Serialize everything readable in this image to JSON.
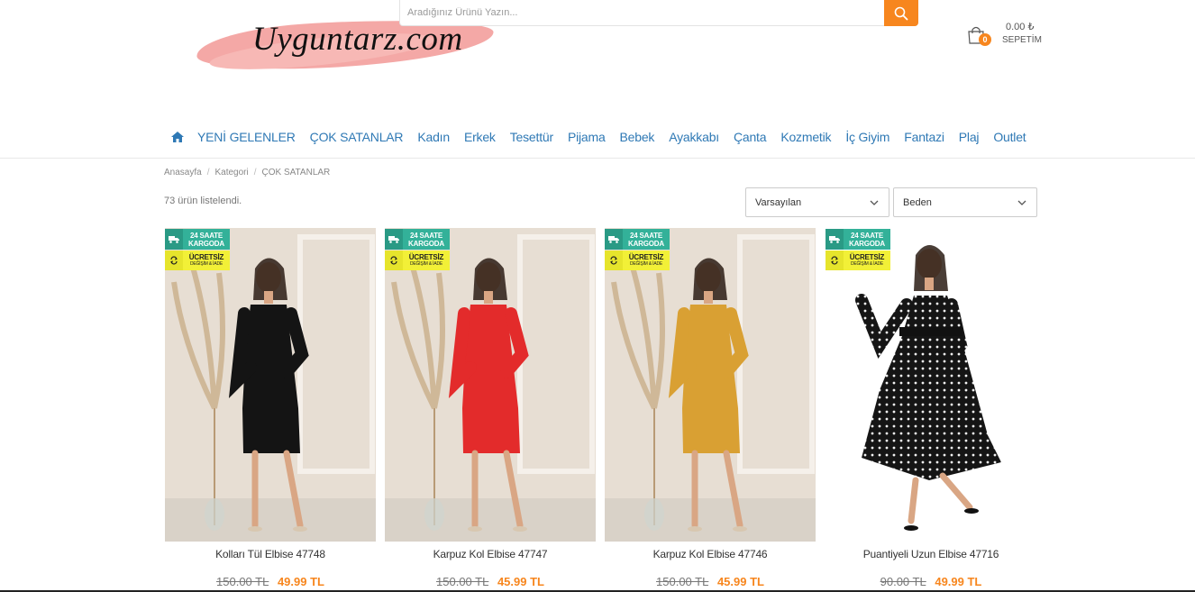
{
  "header": {
    "logo_text": "Uyguntarz.com",
    "search_placeholder": "Aradığınız Ürünü Yazın...",
    "cart": {
      "amount": "0.00 ₺",
      "label": "SEPETİM",
      "count": "0"
    }
  },
  "nav": {
    "items": [
      "YENİ GELENLER",
      "ÇOK SATANLAR",
      "Kadın",
      "Erkek",
      "Tesettür",
      "Pijama",
      "Bebek",
      "Ayakkabı",
      "Çanta",
      "Kozmetik",
      "İç Giyim",
      "Fantazi",
      "Plaj",
      "Outlet"
    ]
  },
  "breadcrumb": [
    "Anasayfa",
    "Kategori",
    "ÇOK SATANLAR"
  ],
  "listing": {
    "count_text": "73 ürün listelendi.",
    "sort_value": "Varsayılan",
    "size_value": "Beden"
  },
  "badges": {
    "shipping_line1": "24 SAATE",
    "shipping_line2": "KARGODA",
    "return_line1": "ÜCRETSİZ",
    "return_line2": "DEĞİŞİM & İADE"
  },
  "products": [
    {
      "title": "Kolları Tül Elbise 47748",
      "old_price": "150.00 TL",
      "new_price": "49.99 TL",
      "dress_color": "#141414"
    },
    {
      "title": "Karpuz Kol Elbise 47747",
      "old_price": "150.00 TL",
      "new_price": "45.99 TL",
      "dress_color": "#e32b2b"
    },
    {
      "title": "Karpuz Kol Elbise 47746",
      "old_price": "150.00 TL",
      "new_price": "45.99 TL",
      "dress_color": "#d9a033"
    },
    {
      "title": "Puantiyeli Uzun Elbise 47716",
      "old_price": "90.00 TL",
      "new_price": "49.99 TL",
      "dress_color": "#151515"
    }
  ],
  "colors": {
    "accent": "#f7861e",
    "nav_link": "#2f79b5",
    "badge_green": "#33b199",
    "badge_yellow": "#f2f037"
  }
}
